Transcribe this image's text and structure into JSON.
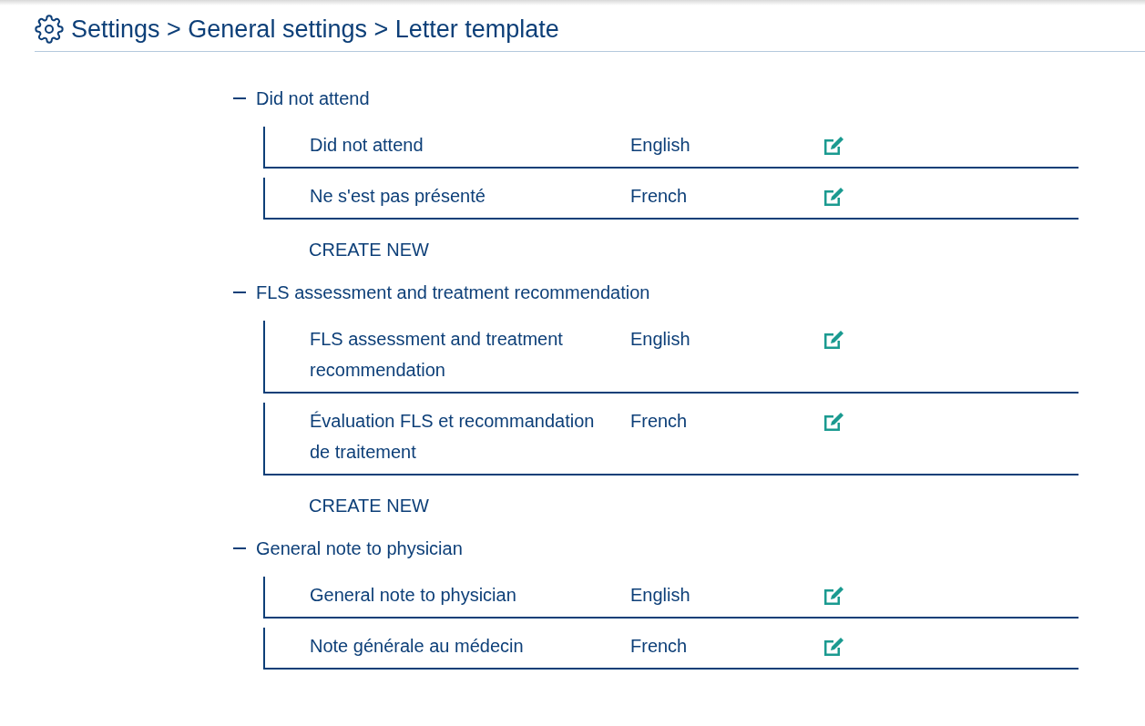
{
  "breadcrumb": "Settings > General settings > Letter template",
  "groups": [
    {
      "title": "Did not attend",
      "expanded": true,
      "templates": [
        {
          "name": "Did not attend",
          "language": "English"
        },
        {
          "name": "Ne s'est pas présenté",
          "language": "French"
        }
      ],
      "create_label": "CREATE NEW"
    },
    {
      "title": "FLS assessment and treatment recommendation",
      "expanded": true,
      "templates": [
        {
          "name": "FLS assessment and treatment recommendation",
          "language": "English"
        },
        {
          "name": "Évaluation FLS et recommandation de traitement",
          "language": "French"
        }
      ],
      "create_label": "CREATE NEW"
    },
    {
      "title": "General note to physician",
      "expanded": true,
      "templates": [
        {
          "name": "General note to physician",
          "language": "English"
        },
        {
          "name": "Note générale au médecin",
          "language": "French"
        }
      ]
    }
  ]
}
